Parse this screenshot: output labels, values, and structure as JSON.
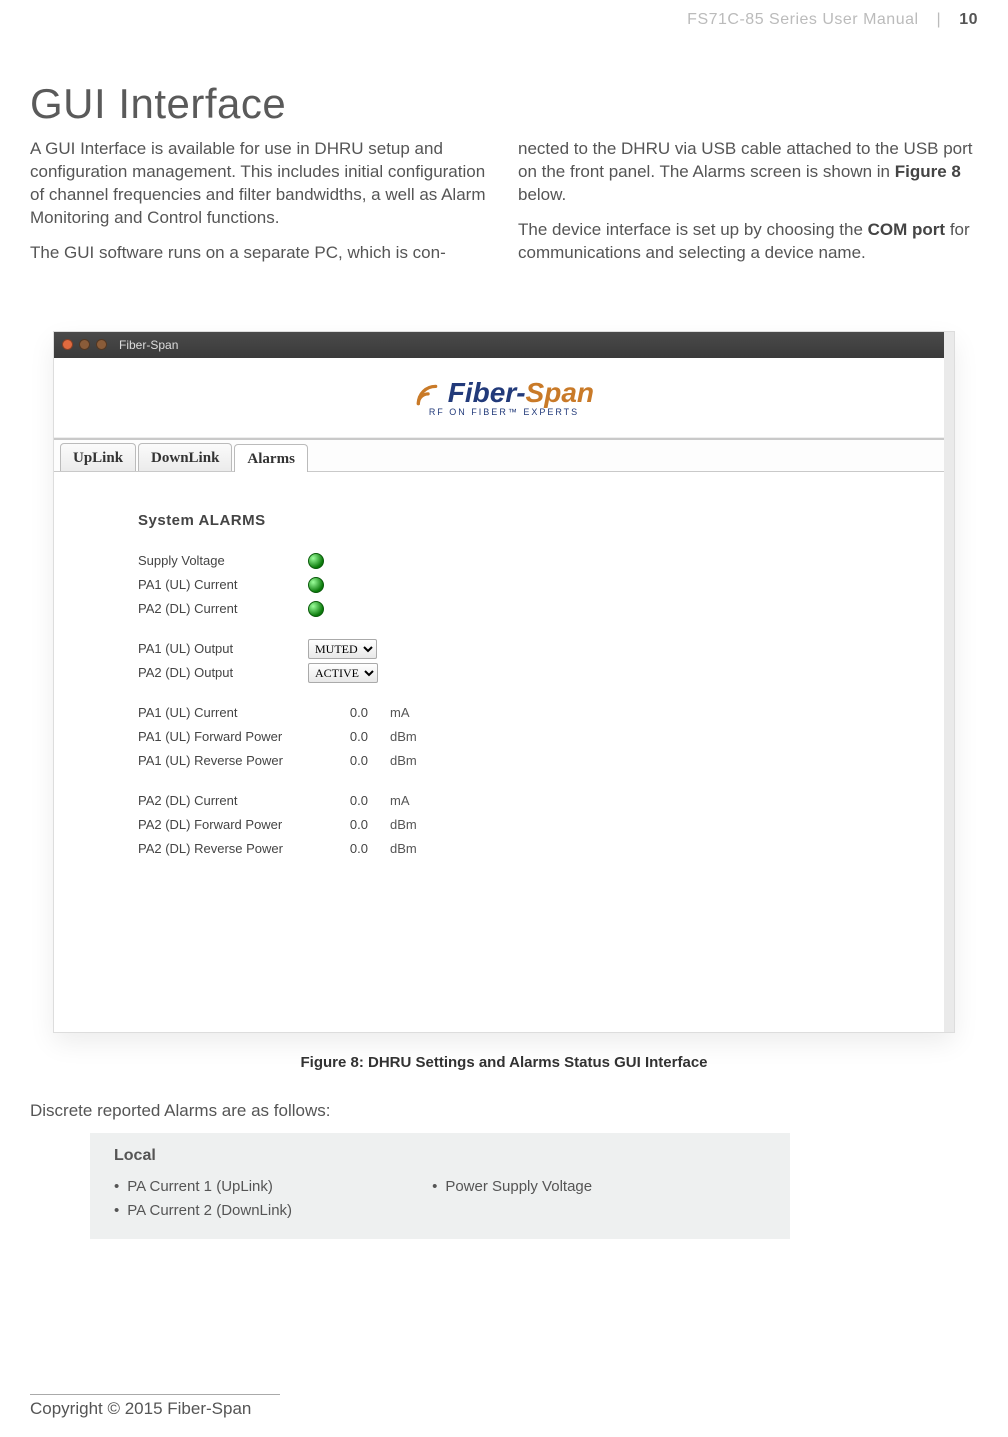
{
  "header": {
    "manual_title": "FS71C-85 Series User Manual",
    "separator": "|",
    "page_number": "10"
  },
  "section": {
    "title": "GUI Interface",
    "para1": "A GUI Interface is available for use in DHRU setup and configuration management. This includes initial configuration of channel frequencies and filter bandwidths, a well as Alarm Monitoring and Control functions.",
    "para2": "The GUI software runs on a separate PC, which is con-",
    "para3_pre": "nected to the DHRU via USB cable attached to the USB port on the front panel. The Alarms screen is shown in ",
    "para3_bold": "Figure 8",
    "para3_post": " below.",
    "para4_pre": "The device interface is set up by choosing the ",
    "para4_bold": "COM port",
    "para4_post": " for communications and selecting a device name."
  },
  "window": {
    "title": "Fiber-Span",
    "logo_brand_left": "Fiber-",
    "logo_brand_right": "Span",
    "logo_tagline": "RF ON FIBER™ EXPERTS",
    "tabs": {
      "uplink": "UpLink",
      "downlink": "DownLink",
      "alarms": "Alarms"
    }
  },
  "alarms": {
    "heading": "System ALARMS",
    "status_rows": {
      "supply_voltage": "Supply Voltage",
      "pa1_ul_current": "PA1 (UL) Current",
      "pa2_dl_current": "PA2 (DL) Current"
    },
    "output_rows": {
      "pa1_ul_output": {
        "label": "PA1 (UL) Output",
        "value": "MUTED"
      },
      "pa2_dl_output": {
        "label": "PA2 (DL) Output",
        "value": "ACTIVE"
      }
    },
    "metrics": {
      "r1": {
        "label": "PA1 (UL) Current",
        "value": "0.0",
        "unit": "mA"
      },
      "r2": {
        "label": "PA1 (UL) Forward Power",
        "value": "0.0",
        "unit": "dBm"
      },
      "r3": {
        "label": "PA1 (UL) Reverse Power",
        "value": "0.0",
        "unit": "dBm"
      },
      "r4": {
        "label": "PA2 (DL) Current",
        "value": "0.0",
        "unit": "mA"
      },
      "r5": {
        "label": "PA2 (DL) Forward Power",
        "value": "0.0",
        "unit": "dBm"
      },
      "r6": {
        "label": "PA2 (DL) Reverse Power",
        "value": "0.0",
        "unit": "dBm"
      }
    }
  },
  "figure_caption": "Figure 8: DHRU Settings and Alarms Status GUI Interface",
  "discrete": {
    "intro": "Discrete reported Alarms are as follows:",
    "heading": "Local",
    "col1": {
      "i1": "PA Current 1 (UpLink)",
      "i2": "PA Current 2 (DownLink)"
    },
    "col2": {
      "i1": "Power Supply Voltage"
    }
  },
  "footer": {
    "copyright": "Copyright © 2015 Fiber-Span"
  }
}
